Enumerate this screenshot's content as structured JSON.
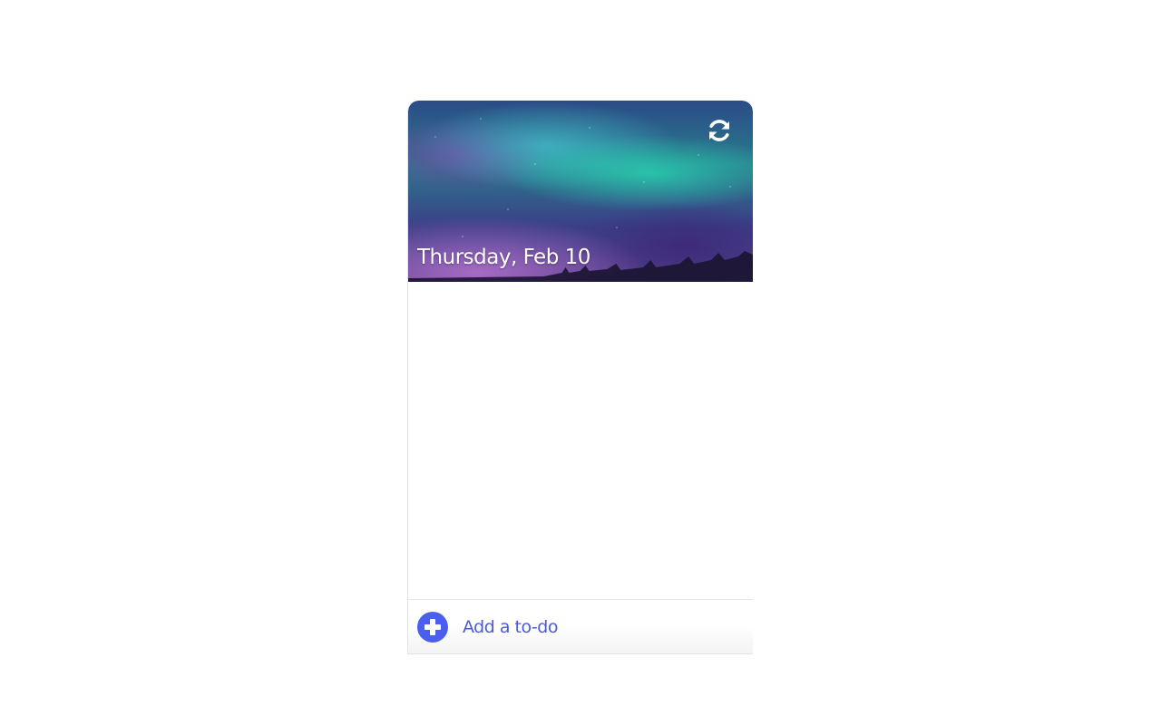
{
  "header": {
    "date": "Thursday, Feb 10",
    "refresh_icon": "refresh-icon"
  },
  "footer": {
    "add_label": "Add a to-do",
    "add_icon": "plus-circle-icon"
  },
  "colors": {
    "accent": "#4a5ff0",
    "accent_text": "#4a5bd8"
  },
  "todos": []
}
